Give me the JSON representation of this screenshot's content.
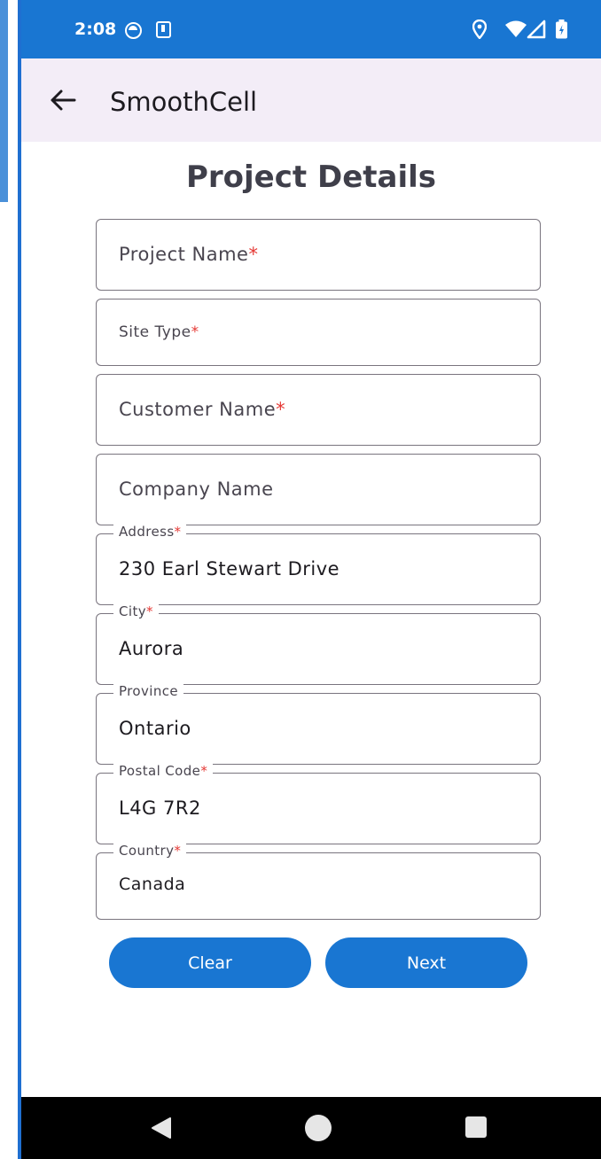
{
  "status_bar": {
    "time": "2:08",
    "icons_left": [
      "face-icon",
      "download-icon"
    ],
    "icons_right": [
      "location-icon",
      "wifi-icon",
      "signal-icon",
      "battery-icon"
    ]
  },
  "app_bar": {
    "back_icon": "arrow-left-icon",
    "title": "SmoothCell"
  },
  "page": {
    "title": "Project Details"
  },
  "fields": {
    "project_name": {
      "label": "Project Name",
      "required": "*",
      "value": ""
    },
    "site_type": {
      "label": "Site Type",
      "required": "*",
      "value": ""
    },
    "customer_name": {
      "label": "Customer Name",
      "required": "*",
      "value": ""
    },
    "company_name": {
      "label": "Company Name",
      "value": ""
    },
    "address": {
      "label": "Address",
      "required": "*",
      "value": "230 Earl Stewart Drive"
    },
    "city": {
      "label": "City",
      "required": "*",
      "value": "Aurora"
    },
    "province": {
      "label": "Province",
      "value": "Ontario"
    },
    "postal_code": {
      "label": "Postal Code",
      "required": "*",
      "value": "L4G 7R2"
    },
    "country": {
      "label": "Country",
      "required": "*",
      "value": "Canada"
    }
  },
  "buttons": {
    "clear": "Clear",
    "next": "Next"
  },
  "nav": {
    "icons": [
      "nav-back-icon",
      "nav-home-icon",
      "nav-recents-icon"
    ]
  },
  "colors": {
    "primary": "#1976d2",
    "app_bar_bg": "#f3edf7",
    "required": "#e53935",
    "outline": "#79747e"
  }
}
